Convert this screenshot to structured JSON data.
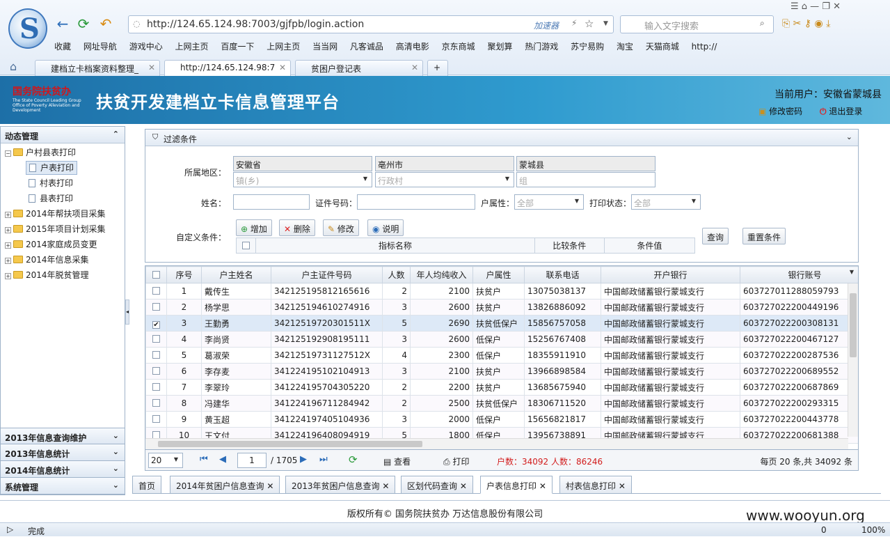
{
  "browser": {
    "url": "http://124.65.124.98:7003/gjfpb/login.action",
    "accelerator": "加速器",
    "search_placeholder": "输入文字搜索",
    "bookmarks": [
      "收藏",
      "网址导航",
      "游戏中心",
      "上网主页",
      "百度一下",
      "上网主页",
      "当当网",
      "凡客诚品",
      "高清电影",
      "京东商城",
      "聚划算",
      "热门游戏",
      "苏宁易购",
      "淘宝",
      "天猫商城",
      "http://"
    ],
    "tabs": [
      "建档立卡档案资料整理_",
      "http://124.65.124.98:7",
      "贫困户登记表"
    ]
  },
  "header": {
    "logo_text": "国务院扶贫办",
    "logo_sub": "The State Council Leading Group Office of Poverty Alleviation and Development",
    "title": "扶贫开发建档立卡信息管理平台",
    "user": "当前用户：安徽省蒙城县",
    "change_pw": "修改密码",
    "logout": "退出登录"
  },
  "left": {
    "section1": "动态管理",
    "tree": {
      "root": "户村县表打印",
      "children": [
        "户表打印",
        "村表打印",
        "县表打印"
      ],
      "folders": [
        "2014年帮扶项目采集",
        "2015年项目计划采集",
        "2014家庭成员变更",
        "2014年信息采集",
        "2014年脱贫管理"
      ]
    },
    "bottom": [
      "2013年信息查询维护",
      "2013年信息统计",
      "2014年信息统计",
      "系统管理"
    ]
  },
  "filter": {
    "title": "过滤条件",
    "region_label": "所属地区：",
    "province": "安徽省",
    "city": "亳州市",
    "county": "蒙城县",
    "town_ph": "镇(乡)",
    "village_ph": "行政村",
    "group_ph": "组",
    "name_label": "姓名：",
    "id_label": "证件号码：",
    "attr_label": "户属性：",
    "attr_value": "全部",
    "print_label": "打印状态：",
    "print_value": "全部",
    "custom_label": "自定义条件：",
    "add": "增加",
    "delete": "删除",
    "edit": "修改",
    "help": "说明",
    "cond_cols": [
      "指标名称",
      "比较条件",
      "条件值"
    ],
    "query": "查询",
    "reset": "重置条件"
  },
  "grid": {
    "columns": [
      "序号",
      "户主姓名",
      "户主证件号码",
      "人数",
      "年人均纯收入",
      "户属性",
      "联系电话",
      "开户银行",
      "银行账号"
    ],
    "rows": [
      [
        "1",
        "戴传生",
        "342125195812165616",
        "2",
        "2100",
        "扶贫户",
        "13075038137",
        "中国邮政储蓄银行蒙城支行",
        "603727011288059793"
      ],
      [
        "2",
        "杨学思",
        "342125194610274916",
        "3",
        "2600",
        "扶贫户",
        "13826886092",
        "中国邮政储蓄银行蒙城支行",
        "603727022200449196"
      ],
      [
        "3",
        "王勤勇",
        "34212519720301511X",
        "5",
        "2690",
        "扶贫低保户",
        "15856757058",
        "中国邮政储蓄银行蒙城支行",
        "603727022200308131"
      ],
      [
        "4",
        "李尚贤",
        "342125192908195111",
        "3",
        "2600",
        "低保户",
        "15256767408",
        "中国邮政储蓄银行蒙城支行",
        "603727022200467127"
      ],
      [
        "5",
        "葛淑荣",
        "34212519731127512X",
        "4",
        "2300",
        "低保户",
        "18355911910",
        "中国邮政储蓄银行蒙城支行",
        "603727022200287536"
      ],
      [
        "6",
        "李存麦",
        "341224195102104913",
        "3",
        "2100",
        "扶贫户",
        "13966898584",
        "中国邮政储蓄银行蒙城支行",
        "603727022200689552"
      ],
      [
        "7",
        "李翠玲",
        "341224195704305220",
        "2",
        "2200",
        "扶贫户",
        "13685675940",
        "中国邮政储蓄银行蒙城支行",
        "603727022200687869"
      ],
      [
        "8",
        "冯建华",
        "341224196711284942",
        "2",
        "2500",
        "扶贫低保户",
        "18306711520",
        "中国邮政储蓄银行蒙城支行",
        "603727022200293315"
      ],
      [
        "9",
        "黄玉超",
        "341224197405104936",
        "3",
        "2000",
        "低保户",
        "15656821817",
        "中国邮政储蓄银行蒙城支行",
        "603727022200443778"
      ],
      [
        "10",
        "王文付",
        "341224196408094919",
        "5",
        "1800",
        "低保户",
        "13956738891",
        "中国邮政储蓄银行蒙城支行",
        "603727022200681388"
      ]
    ],
    "checked_row": 2
  },
  "pager": {
    "page_size": "20",
    "page": "1",
    "total_pages": "/ 1705",
    "view": "查看",
    "print": "打印",
    "counts": "户数：34092 人数：86246",
    "summary": "每页 20 条,共 34092 条"
  },
  "bottom_tabs": [
    "首页",
    "2014年贫困户信息查询",
    "2013年贫困户信息查询",
    "区划代码查询",
    "户表信息打印",
    "村表信息打印"
  ],
  "footer": "版权所有© 国务院扶贫办 万达信息股份有限公司",
  "status": "完成",
  "status_zoom": "100%",
  "status_count": "0",
  "watermark": "www.wooyun.org"
}
